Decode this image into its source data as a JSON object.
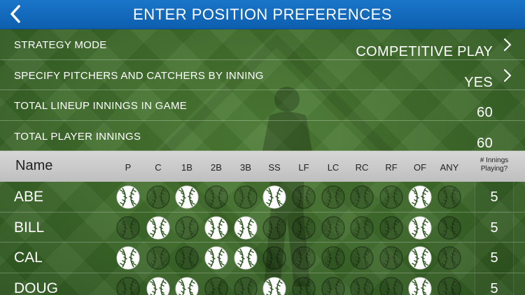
{
  "header": {
    "title": "ENTER POSITION PREFERENCES",
    "back_icon": "chevron-left-icon"
  },
  "settings": [
    {
      "label": "STRATEGY MODE",
      "value": "COMPETITIVE PLAY",
      "has_chevron": true
    },
    {
      "label": "SPECIFY PITCHERS AND CATCHERS BY INNING",
      "value": "YES",
      "has_chevron": true
    },
    {
      "label": "TOTAL LINEUP INNINGS IN GAME",
      "value": "60",
      "has_chevron": false
    },
    {
      "label": "TOTAL PLAYER INNINGS",
      "value": "60",
      "has_chevron": false
    }
  ],
  "table": {
    "name_header": "Name",
    "positions": [
      "P",
      "C",
      "1B",
      "2B",
      "3B",
      "SS",
      "LF",
      "LC",
      "RC",
      "RF",
      "OF",
      "ANY"
    ],
    "innings_header": "# Innings Playing?",
    "players": [
      {
        "name": "ABE",
        "selected": [
          true,
          false,
          true,
          false,
          false,
          true,
          false,
          false,
          false,
          false,
          true,
          false
        ],
        "innings": "5"
      },
      {
        "name": "BILL",
        "selected": [
          false,
          true,
          false,
          true,
          true,
          false,
          false,
          false,
          false,
          false,
          true,
          false
        ],
        "innings": "5"
      },
      {
        "name": "CAL",
        "selected": [
          true,
          false,
          false,
          true,
          true,
          false,
          false,
          false,
          false,
          false,
          true,
          false
        ],
        "innings": "5"
      },
      {
        "name": "DOUG",
        "selected": [
          false,
          true,
          true,
          false,
          false,
          true,
          false,
          false,
          false,
          false,
          true,
          false
        ],
        "innings": "5"
      }
    ]
  },
  "colors": {
    "header_blue": "#1a75c9",
    "field_green": "#3f6a2c",
    "table_header_gray": "#cfcfcf",
    "ball_selected": "#ffffff",
    "ball_stitch": "#2f5a22"
  },
  "icons": {
    "chevron": "chevron-right-icon",
    "ball_selected": "baseball-selected-icon",
    "ball_unselected": "baseball-unselected-icon"
  }
}
